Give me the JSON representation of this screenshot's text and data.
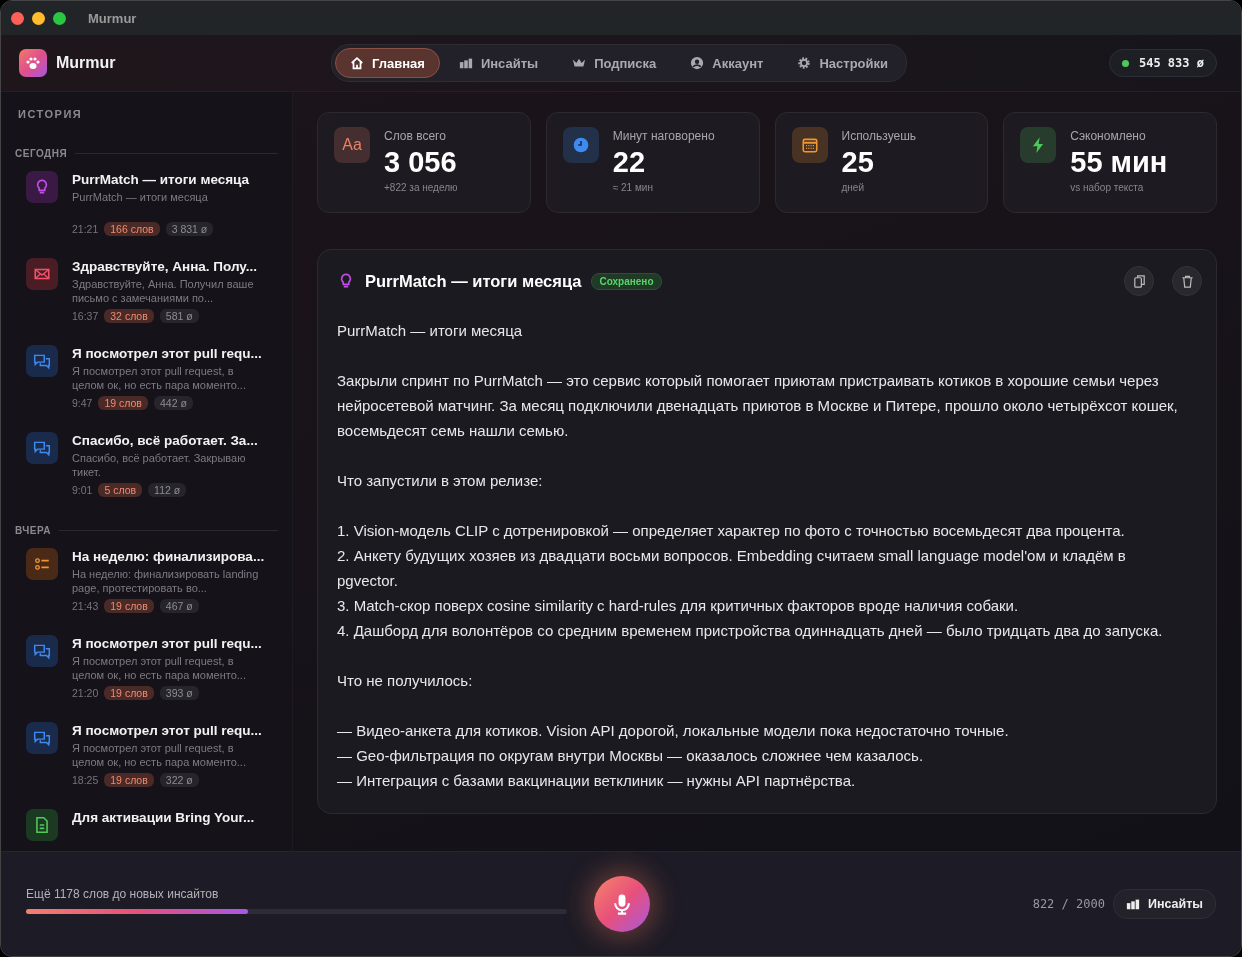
{
  "window": {
    "title": "Murmur"
  },
  "app": {
    "name": "Murmur"
  },
  "nav": [
    {
      "label": "Главная",
      "selected": true
    },
    {
      "label": "Инсайты",
      "selected": false
    },
    {
      "label": "Подписка",
      "selected": false
    },
    {
      "label": "Аккаунт",
      "selected": false
    },
    {
      "label": "Настройки",
      "selected": false
    }
  ],
  "balance": {
    "value": "545 833 ø",
    "online": true
  },
  "sidebar": {
    "title": "ИСТОРИЯ",
    "groups": [
      {
        "label": "СЕГОДНЯ",
        "items": [
          {
            "kind": "idea",
            "title": "PurrMatch — итоги месяца",
            "preview": "PurrMatch — итоги месяца",
            "time": "21:21",
            "words": "166 слов",
            "count": "3 831 ø"
          },
          {
            "kind": "mail",
            "title": "Здравствуйте, Анна. Полу...",
            "preview": "Здравствуйте, Анна. Получил ваше письмо с замечаниями по...",
            "time": "16:37",
            "words": "32 слов",
            "count": "581 ø"
          },
          {
            "kind": "chat",
            "title": "Я посмотрел этот pull requ...",
            "preview": "Я посмотрел этот pull request, в целом ок, но есть пара моменто...",
            "time": "9:47",
            "words": "19 слов",
            "count": "442 ø"
          },
          {
            "kind": "chat",
            "title": "Спасибо, всё работает. За...",
            "preview": "Спасибо, всё работает. Закрываю тикет.",
            "time": "9:01",
            "words": "5 слов",
            "count": "112 ø"
          }
        ]
      },
      {
        "label": "ВЧЕРА",
        "items": [
          {
            "kind": "list",
            "title": "На неделю: финализирова...",
            "preview": "На неделю: финализировать landing page, протестировать во...",
            "time": "21:43",
            "words": "19 слов",
            "count": "467 ø"
          },
          {
            "kind": "chat",
            "title": "Я посмотрел этот pull requ...",
            "preview": "Я посмотрел этот pull request, в целом ок, но есть пара моменто...",
            "time": "21:20",
            "words": "19 слов",
            "count": "393 ø"
          },
          {
            "kind": "chat",
            "title": "Я посмотрел этот pull requ...",
            "preview": "Я посмотрел этот pull request, в целом ок, но есть пара моменто...",
            "time": "18:25",
            "words": "19 слов",
            "count": "322 ø"
          },
          {
            "kind": "doc",
            "title": "Для активации Bring Your..."
          }
        ]
      }
    ]
  },
  "stats": [
    {
      "kind": "text",
      "icon_text": "Aa",
      "color": "#e8826a",
      "label": "Слов всего",
      "value": "3 056",
      "note": "+822 за неделю"
    },
    {
      "kind": "clock",
      "color": "#3d8bf0",
      "label": "Минут наговорено",
      "value": "22",
      "note": "≈ 21 мин"
    },
    {
      "kind": "calendar",
      "color": "#f0962e",
      "label": "Используешь",
      "value": "25",
      "note": "дней"
    },
    {
      "kind": "bolt",
      "color": "#4fc85a",
      "label": "Сэкономлено",
      "value": "55 мин",
      "note": "vs набор текста"
    }
  ],
  "document": {
    "title": "PurrMatch — итоги месяца",
    "badge": "Сохранено",
    "paragraphs": [
      "PurrMatch — итоги месяца",
      "Закрыли спринт по PurrMatch — это сервис который помогает приютам пристраивать котиков в хорошие семьи через нейросетевой матчинг. За месяц подключили двенадцать приютов в Москве и Питере, прошло около четырёхсот кошек, восемьдесят семь нашли семью.",
      "Что запустили в этом релизе:",
      [
        "1. Vision-модель CLIP с дотренировкой — определяет характер по фото с точностью восемьдесят два процента.",
        "2. Анкету будущих хозяев из двадцати восьми вопросов. Embedding считаем small language model'ом и кладём в pgvector.",
        "3. Match-скор поверх cosine similarity с hard-rules для критичных факторов вроде наличия собаки.",
        "4. Дашборд для волонтёров со средним временем пристройства одиннадцать дней — было тридцать два до запуска."
      ],
      "Что не получилось:",
      [
        "— Видео-анкета для котиков. Vision API дорогой, локальные модели пока недостаточно точные.",
        "— Geo-фильтрация по округам внутри Москвы — оказалось сложнее чем казалось.",
        "— Интеграция с базами вакцинации ветклиник — нужны API партнёрства."
      ]
    ]
  },
  "footer": {
    "remaining": "Ещё 1178 слов до новых инсайтов",
    "level": 0.411,
    "counter": "822 / 2000",
    "insights_button": "Инсайты"
  }
}
